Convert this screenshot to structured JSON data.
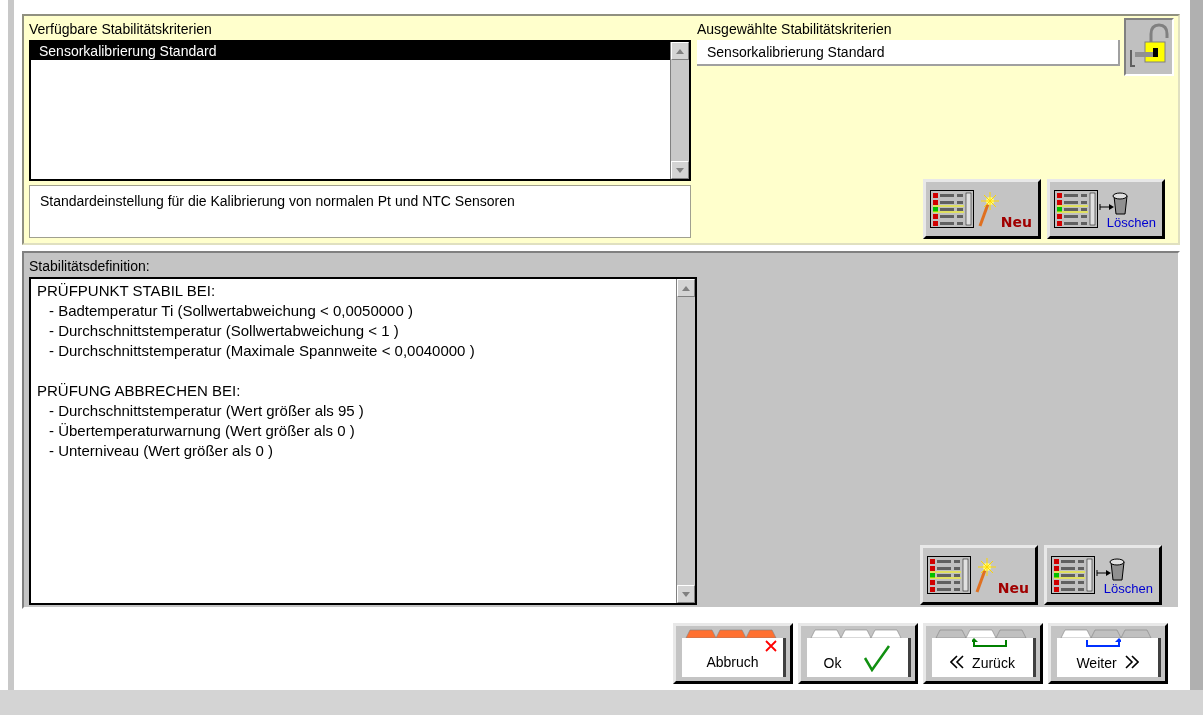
{
  "available": {
    "label": "Verfügbare Stabilitätskriterien",
    "items": [
      {
        "text": "Sensorkalibrierung Standard",
        "selected": true
      }
    ],
    "description": "Standardeinstellung für die Kalibrierung von normalen Pt und NTC Sensoren"
  },
  "chosen": {
    "label": "Ausgewählte Stabilitätskriterien",
    "value": "Sensorkalibrierung Standard"
  },
  "top_actions": [
    {
      "kind": "new",
      "label": "Neu"
    },
    {
      "kind": "delete",
      "label": "Löschen"
    }
  ],
  "definition": {
    "label": "Stabilitätsdefinition:",
    "sections": [
      {
        "heading": "PRÜFPUNKT STABIL BEI:",
        "items": [
          "- Badtemperatur Ti (Sollwertabweichung < 0,0050000 )",
          "- Durchschnittstemperatur (Sollwertabweichung < 1 )",
          "- Durchschnittstemperatur (Maximale Spannweite < 0,0040000 )"
        ]
      },
      {
        "heading": "PRÜFUNG ABBRECHEN BEI:",
        "items": [
          "- Durchschnittstemperatur (Wert größer als 95 )",
          "- Übertemperaturwarnung (Wert größer als 0 )",
          "- Unterniveau (Wert größer als 0 )"
        ]
      }
    ]
  },
  "bottom_actions": [
    {
      "kind": "new",
      "label": "Neu"
    },
    {
      "kind": "delete",
      "label": "Löschen"
    }
  ],
  "footer_buttons": [
    {
      "kind": "cancel",
      "label": "Abbruch"
    },
    {
      "kind": "ok",
      "label": "Ok"
    },
    {
      "kind": "back",
      "label": "Zurück"
    },
    {
      "kind": "next",
      "label": "Weiter"
    }
  ]
}
